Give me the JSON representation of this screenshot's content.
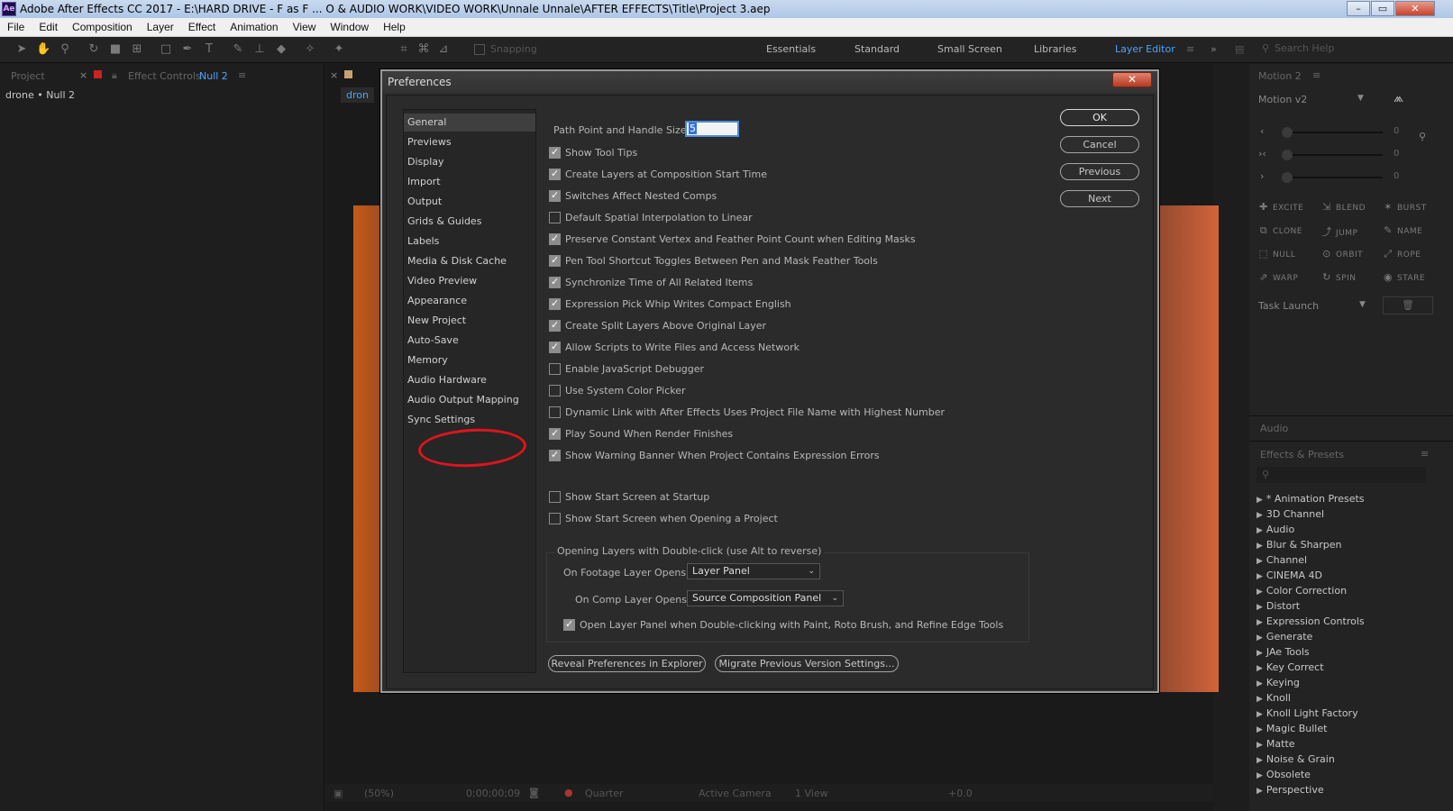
{
  "window": {
    "app_icon": "Ae",
    "title": "Adobe After Effects CC 2017 - E:\\HARD DRIVE - F as F ... O & AUDIO WORK\\VIDEO WORK\\Unnale Unnale\\AFTER EFFECTS\\Title\\Project 3.aep",
    "minimize": "–",
    "maximize": "▭",
    "close": "✕"
  },
  "menu": [
    "File",
    "Edit",
    "Composition",
    "Layer",
    "Effect",
    "Animation",
    "View",
    "Window",
    "Help"
  ],
  "toolbar": {
    "snapping_label": "Snapping",
    "workspaces": [
      "Essentials",
      "Standard",
      "Small Screen",
      "Libraries",
      "Layer Editor"
    ],
    "active_workspace": "Layer Editor",
    "overflow": "»",
    "search_placeholder": "Search Help"
  },
  "project_panel": {
    "tab_project": "Project",
    "tab_effect_controls": "Effect Controls",
    "tab_effect_controls_target": "Null 2",
    "breadcrumb": "drone • Null 2"
  },
  "comp_panel": {
    "tab_label": "dron",
    "zoom": "(50%)",
    "timecode": "0;00;00;09",
    "resolution": "Quarter",
    "camera": "Active Camera",
    "views": "1 View",
    "exposure": "+0.0"
  },
  "motion_panel": {
    "tab": "Motion 2",
    "preset": "Motion v2",
    "sliders": [
      {
        "icon": "‹",
        "value": "0"
      },
      {
        "icon": "›‹",
        "value": "0"
      },
      {
        "icon": "›",
        "value": "0"
      }
    ],
    "buttons": [
      {
        "icon": "✚",
        "label": "EXCITE"
      },
      {
        "icon": "⇲",
        "label": "BLEND"
      },
      {
        "icon": "✶",
        "label": "BURST"
      },
      {
        "icon": "⧉",
        "label": "CLONE"
      },
      {
        "icon": "⤴",
        "label": "JUMP"
      },
      {
        "icon": "✎",
        "label": "NAME"
      },
      {
        "icon": "⬚",
        "label": "NULL"
      },
      {
        "icon": "⊙",
        "label": "ORBIT"
      },
      {
        "icon": "⤢",
        "label": "ROPE"
      },
      {
        "icon": "⇗",
        "label": "WARP"
      },
      {
        "icon": "↻",
        "label": "SPIN"
      },
      {
        "icon": "◉",
        "label": "STARE"
      }
    ],
    "task_launch": "Task Launch"
  },
  "audio_panel": {
    "tab": "Audio"
  },
  "effects_presets": {
    "tab": "Effects & Presets",
    "items": [
      "* Animation Presets",
      "3D Channel",
      "Audio",
      "Blur & Sharpen",
      "Channel",
      "CINEMA 4D",
      "Color Correction",
      "Distort",
      "Expression Controls",
      "Generate",
      "JAe Tools",
      "Key Correct",
      "Keying",
      "Knoll",
      "Knoll Light Factory",
      "Magic Bullet",
      "Matte",
      "Noise & Grain",
      "Obsolete",
      "Perspective"
    ]
  },
  "dialog": {
    "title": "Preferences",
    "close": "✕",
    "categories": [
      "General",
      "Previews",
      "Display",
      "Import",
      "Output",
      "Grids & Guides",
      "Labels",
      "Media & Disk Cache",
      "Video Preview",
      "Appearance",
      "New Project",
      "Auto-Save",
      "Memory",
      "Audio Hardware",
      "Audio Output Mapping",
      "Sync Settings"
    ],
    "selected_category": "General",
    "path_point_label": "Path Point and Handle Size:",
    "path_point_value": "5",
    "options": [
      {
        "label": "Show Tool Tips",
        "checked": true
      },
      {
        "label": "Create Layers at Composition Start Time",
        "checked": true
      },
      {
        "label": "Switches Affect Nested Comps",
        "checked": true
      },
      {
        "label": "Default Spatial Interpolation to Linear",
        "checked": false
      },
      {
        "label": "Preserve Constant Vertex and Feather Point Count when Editing Masks",
        "checked": true
      },
      {
        "label": "Pen Tool Shortcut Toggles Between Pen and Mask Feather Tools",
        "checked": true
      },
      {
        "label": "Synchronize Time of All Related Items",
        "checked": true
      },
      {
        "label": "Expression Pick Whip Writes Compact English",
        "checked": true
      },
      {
        "label": "Create Split Layers Above Original Layer",
        "checked": true
      },
      {
        "label": "Allow Scripts to Write Files and Access Network",
        "checked": true
      },
      {
        "label": "Enable JavaScript Debugger",
        "checked": false
      },
      {
        "label": "Use System Color Picker",
        "checked": false
      },
      {
        "label": "Dynamic Link with After Effects Uses Project File Name with Highest Number",
        "checked": false
      },
      {
        "label": "Play Sound When Render Finishes",
        "checked": true
      },
      {
        "label": "Show Warning Banner When Project Contains Expression Errors",
        "checked": true
      }
    ],
    "start_options": [
      {
        "label": "Show Start Screen at Startup",
        "checked": false
      },
      {
        "label": "Show Start Screen when Opening a Project",
        "checked": false
      }
    ],
    "double_click_group": {
      "title": "Opening Layers with Double-click (use Alt to reverse)",
      "footage_label": "On Footage Layer Opens:",
      "footage_value": "Layer Panel",
      "comp_label": "On Comp Layer Opens:",
      "comp_value": "Source Composition Panel",
      "open_layer_panel_label": "Open Layer Panel when Double-clicking with Paint, Roto Brush, and Refine Edge Tools",
      "open_layer_panel_checked": true
    },
    "buttons": {
      "ok": "OK",
      "cancel": "Cancel",
      "previous": "Previous",
      "next": "Next"
    },
    "reveal_button": "Reveal Preferences in Explorer",
    "migrate_button": "Migrate Previous Version Settings..."
  },
  "colors": {
    "accent": "#4da3ff",
    "annotation": "#e0141c"
  }
}
